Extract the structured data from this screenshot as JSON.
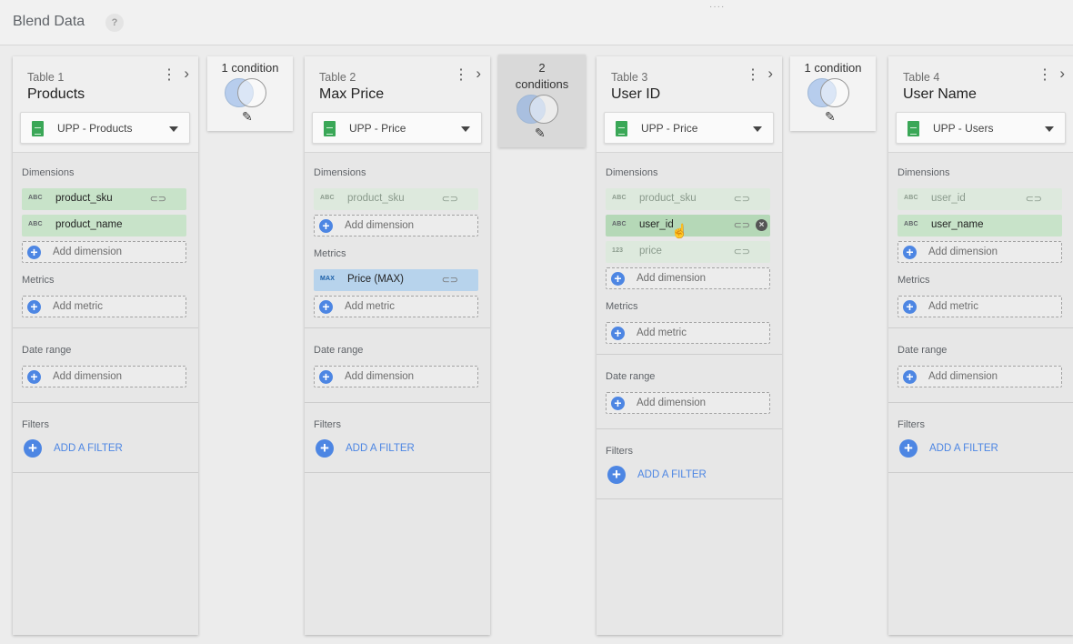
{
  "header": {
    "title": "Blend Data",
    "help": "?",
    "drag": "····"
  },
  "tables": [
    {
      "label": "Table 1",
      "name": "Products",
      "source": "UPP - Products",
      "dimensions_label": "Dimensions",
      "dimensions": [
        {
          "type": "ABC",
          "name": "product_sku"
        },
        {
          "type": "ABC",
          "name": "product_name"
        }
      ],
      "add_dimension": "Add dimension",
      "metrics_label": "Metrics",
      "add_metric": "Add metric",
      "date_range_label": "Date range",
      "date_add": "Add dimension",
      "filters_label": "Filters",
      "add_filter": "ADD A FILTER"
    },
    {
      "label": "Table 2",
      "name": "Max Price",
      "source": "UPP - Price",
      "dimensions_label": "Dimensions",
      "dimensions": [
        {
          "type": "ABC",
          "name": "product_sku"
        }
      ],
      "add_dimension": "Add dimension",
      "metrics_label": "Metrics",
      "metrics": [
        {
          "type": "MAX",
          "name": "Price (MAX)"
        }
      ],
      "add_metric": "Add metric",
      "date_range_label": "Date range",
      "date_add": "Add dimension",
      "filters_label": "Filters",
      "add_filter": "ADD A FILTER"
    },
    {
      "label": "Table 3",
      "name": "User ID",
      "source": "UPP - Price",
      "dimensions_label": "Dimensions",
      "dimensions": [
        {
          "type": "ABC",
          "name": "product_sku"
        },
        {
          "type": "ABC",
          "name": "user_id"
        },
        {
          "type": "123",
          "name": "price"
        }
      ],
      "add_dimension": "Add dimension",
      "metrics_label": "Metrics",
      "add_metric": "Add metric",
      "date_range_label": "Date range",
      "date_add": "Add dimension",
      "filters_label": "Filters",
      "add_filter": "ADD A FILTER"
    },
    {
      "label": "Table 4",
      "name": "User Name",
      "source": "UPP - Users",
      "dimensions_label": "Dimensions",
      "dimensions": [
        {
          "type": "ABC",
          "name": "user_id"
        },
        {
          "type": "ABC",
          "name": "user_name"
        }
      ],
      "add_dimension": "Add dimension",
      "metrics_label": "Metrics",
      "add_metric": "Add metric",
      "date_range_label": "Date range",
      "date_add": "Add dimension",
      "filters_label": "Filters",
      "add_filter": "ADD A FILTER"
    }
  ],
  "joins": [
    {
      "label": "1 condition"
    },
    {
      "label_line1": "2",
      "label_line2": "conditions"
    },
    {
      "label": "1 condition"
    }
  ],
  "icons": {
    "kebab": "⋮",
    "chevron": "›",
    "plus": "+",
    "link": "⊂⊃",
    "pencil": "✎",
    "remove": "×",
    "cursor": "☝"
  },
  "colors": {
    "accent": "#4d86e3",
    "dimension": "#c8e3c9",
    "metric": "#b7d3ec",
    "sheets": "#3aa757"
  }
}
